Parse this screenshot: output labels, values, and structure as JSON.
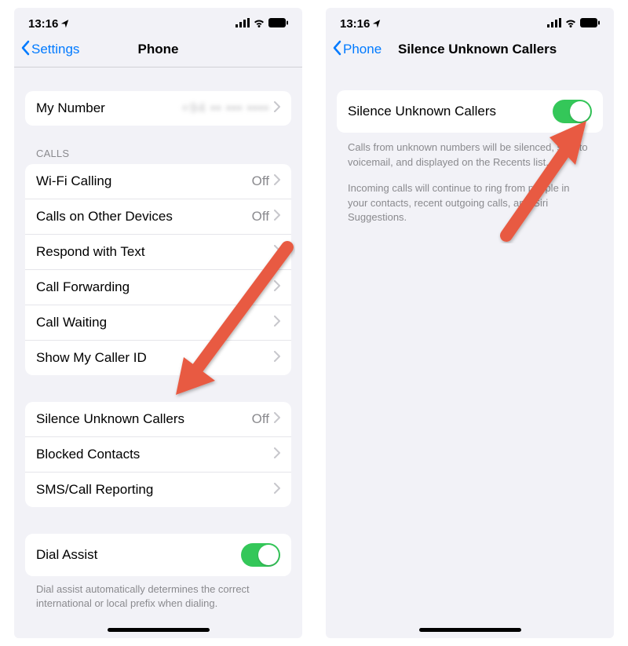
{
  "status": {
    "time": "13:16"
  },
  "left": {
    "back": "Settings",
    "title": "Phone",
    "myNumber": {
      "label": "My Number",
      "value": "+94 ▪▪ ▪▪▪ ▪▪▪▪"
    },
    "callsHeader": "CALLS",
    "calls": [
      {
        "label": "Wi-Fi Calling",
        "value": "Off"
      },
      {
        "label": "Calls on Other Devices",
        "value": "Off"
      },
      {
        "label": "Respond with Text",
        "value": ""
      },
      {
        "label": "Call Forwarding",
        "value": ""
      },
      {
        "label": "Call Waiting",
        "value": ""
      },
      {
        "label": "Show My Caller ID",
        "value": ""
      }
    ],
    "section3": [
      {
        "label": "Silence Unknown Callers",
        "value": "Off"
      },
      {
        "label": "Blocked Contacts",
        "value": ""
      },
      {
        "label": "SMS/Call Reporting",
        "value": ""
      }
    ],
    "dialAssist": {
      "label": "Dial Assist"
    },
    "dialAssistFooter": "Dial assist automatically determines the correct international or local prefix when dialing."
  },
  "right": {
    "back": "Phone",
    "title": "Silence Unknown Callers",
    "row": {
      "label": "Silence Unknown Callers"
    },
    "desc1": "Calls from unknown numbers will be silenced, sent to voicemail, and displayed on the Recents list.",
    "desc2": "Incoming calls will continue to ring from people in your contacts, recent outgoing calls, and Siri Suggestions."
  }
}
